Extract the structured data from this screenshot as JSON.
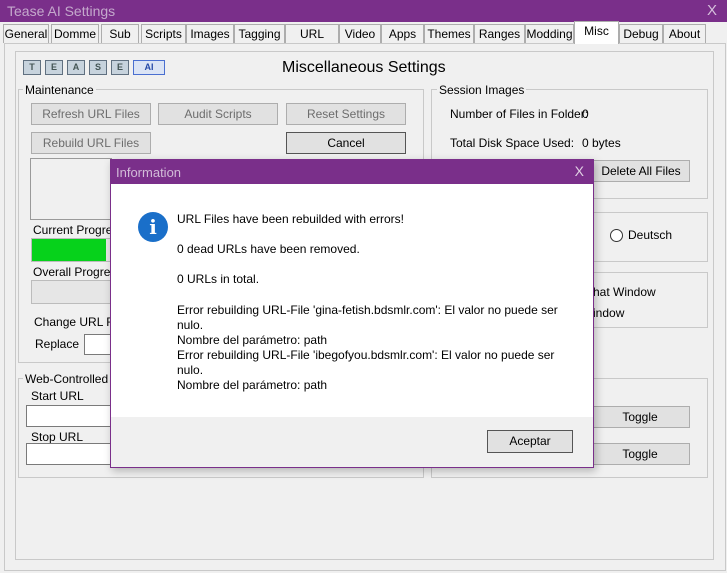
{
  "window": {
    "title": "Tease AI Settings",
    "close_symbol": "X"
  },
  "tabs": [
    "General",
    "Domme",
    "Sub",
    "Scripts",
    "Images",
    "Tagging",
    "URL Files",
    "Video",
    "Apps",
    "Themes",
    "Ranges",
    "Modding",
    "Misc",
    "Debug",
    "About"
  ],
  "active_tab": "Misc",
  "logo_letters": [
    "T",
    "E",
    "A",
    "S",
    "E",
    "AI"
  ],
  "page_title": "Miscellaneous Settings",
  "maintenance": {
    "label": "Maintenance",
    "refresh_url_files": "Refresh URL Files",
    "audit_scripts": "Audit Scripts",
    "reset_settings": "Reset Settings",
    "rebuild_url_files": "Rebuild URL Files",
    "cancel": "Cancel",
    "current_progress": "Current Progress",
    "current_progress_fraction": 0.92,
    "overall_progress": "Overall Progress",
    "change_url_file": "Change URL Fi",
    "replace": "Replace"
  },
  "session_images": {
    "label": "Session Images",
    "num_files_label": "Number of Files in Folder:",
    "num_files_value": "0",
    "disk_space_label": "Total Disk Space Used:",
    "disk_space_value": "0 bytes",
    "delete_all_files": "Delete All Files"
  },
  "language": {
    "deutsch": "Deutsch"
  },
  "chat_window": {
    "line1": "hat Window",
    "line2": "indow"
  },
  "web_controlled": {
    "label": "Web-Controlled Se",
    "start_url": "Start URL",
    "stop_url": "Stop URL",
    "toggle1": "Toggle",
    "toggle2": "Toggle"
  },
  "dialog": {
    "title": "Information",
    "close_symbol": "X",
    "lines": [
      "URL Files have been rebuilded with errors!",
      "0 dead URLs have been removed.",
      "0 URLs in total.",
      "Error rebuilding URL-File 'gina-fetish.bdsmlr.com': El valor no puede ser nulo.",
      "Nombre del parámetro: path",
      "Error rebuilding URL-File 'ibegofyou.bdsmlr.com': El valor no puede ser nulo.",
      "Nombre del parámetro: path"
    ],
    "accept": "Aceptar"
  }
}
